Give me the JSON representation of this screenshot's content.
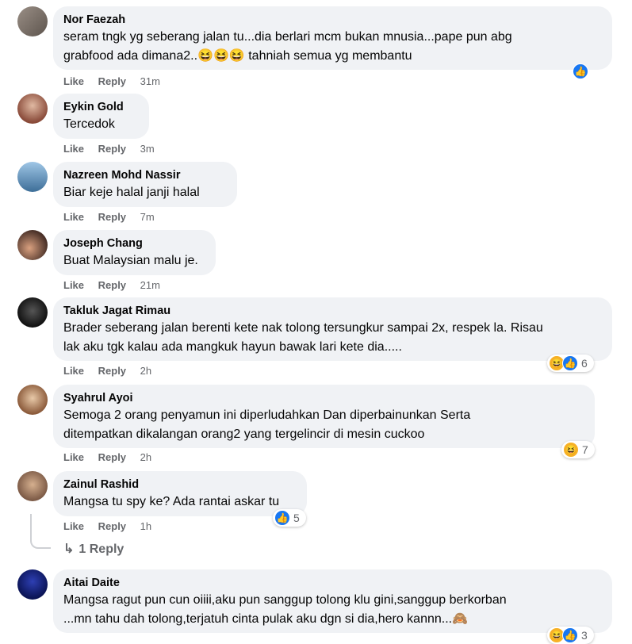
{
  "colors": {
    "bubble": "#f0f2f5",
    "like_blue": "#1877f2",
    "haha_yellow": "#f7b125",
    "meta_gray": "#65676b"
  },
  "action_labels": {
    "like": "Like",
    "reply": "Reply"
  },
  "comments": [
    {
      "name": "Nor Faezah",
      "text_lines": [
        "seram tngk yg seberang jalan tu...dia berlari mcm bukan mnusia...pape pun abg",
        "grabfood ada dimana2..😆😆😆 tahniah semua yg membantu"
      ],
      "time": "31m",
      "reactions": [
        "like"
      ],
      "reaction_count": ""
    },
    {
      "name": "Eykin Gold",
      "text_lines": [
        "Tercedok"
      ],
      "time": "3m"
    },
    {
      "name": "Nazreen Mohd Nassir",
      "text_lines": [
        "Biar keje halal janji halal"
      ],
      "time": "7m"
    },
    {
      "name": "Joseph Chang",
      "text_lines": [
        "Buat Malaysian malu je."
      ],
      "time": "21m"
    },
    {
      "name": "Takluk Jagat Rimau",
      "text_lines": [
        "Brader seberang jalan berenti kete nak tolong tersungkur sampai 2x, respek la. Risau",
        "lak aku tgk kalau ada mangkuk hayun bawak lari kete dia....."
      ],
      "time": "2h",
      "reactions": [
        "haha",
        "like"
      ],
      "reaction_count": "6"
    },
    {
      "name": "Syahrul Ayoi",
      "text_lines": [
        "Semoga 2 orang penyamun ini diperludahkan Dan diperbainunkan Serta",
        "ditempatkan dikalangan orang2 yang tergelincir di mesin cuckoo"
      ],
      "time": "2h",
      "reactions": [
        "haha"
      ],
      "reaction_count": "7"
    },
    {
      "name": "Zainul Rashid",
      "text_lines": [
        "Mangsa tu spy ke? Ada rantai askar tu"
      ],
      "time": "1h",
      "reactions": [
        "like"
      ],
      "reaction_count": "5"
    },
    {
      "name": "Aitai Daite",
      "text_lines": [
        "Mangsa ragut pun cun oiiii,aku pun sanggup tolong klu gini,sanggup berkorban",
        "...mn tahu dah tolong,terjatuh cinta pulak aku dgn si dia,hero kannn...🙈"
      ],
      "time": "",
      "reactions": [
        "haha",
        "like"
      ],
      "reaction_count": "3"
    }
  ],
  "replies_link": "1 Reply",
  "icons": {
    "reply_arrow": "reply-arrow-icon",
    "like": "like-icon",
    "haha": "haha-icon"
  }
}
